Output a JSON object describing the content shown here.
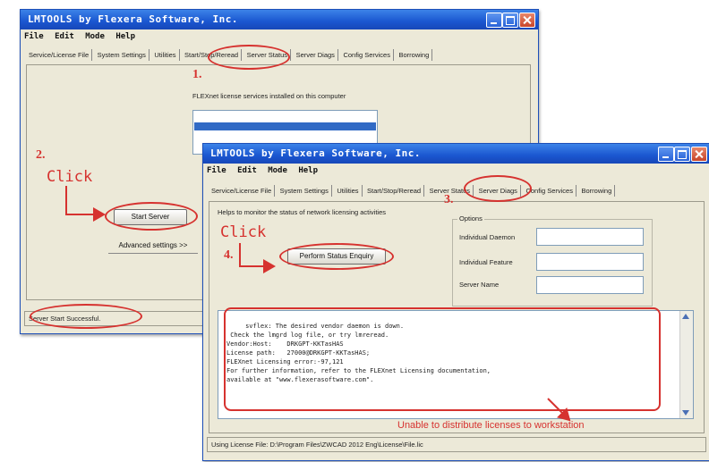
{
  "back_window": {
    "title": "LMTOOLS by Flexera Software, Inc.",
    "menu": [
      "File",
      "Edit",
      "Mode",
      "Help"
    ],
    "tabs": [
      "Service/License File",
      "System Settings",
      "Utilities",
      "Start/Stop/Reread",
      "Server Status",
      "Server Diags",
      "Config Services",
      "Borrowing"
    ],
    "heading": "FLEXnet license services installed on this computer",
    "start_server_label": "Start Server",
    "advanced_settings_label": "Advanced settings >>",
    "status_text": "Server Start Successful."
  },
  "front_window": {
    "title": "LMTOOLS by Flexera Software, Inc.",
    "menu": [
      "File",
      "Edit",
      "Mode",
      "Help"
    ],
    "tabs": [
      "Service/License File",
      "System Settings",
      "Utilities",
      "Start/Stop/Reread",
      "Server Status",
      "Server Diags",
      "Config Services",
      "Borrowing"
    ],
    "helps_text": "Helps to monitor the status of network licensing activities",
    "perform_label": "Perform Status Enquiry",
    "options_label": "Options",
    "individual_daemon_label": "Individual Daemon",
    "individual_feature_label": "Individual Feature",
    "server_name_label": "Server Name",
    "console_lines": [
      "     svflex: The desired vendor daemon is down.",
      " Check the lmgrd log file, or try lmreread.",
      "Vendor:Host:    DRKGPT-KKTasHAS",
      "License path:   27000@DRKGPT-KKTasHAS;",
      "FLEXnet Licensing error:-97,121",
      "For further information, refer to the FLEXnet Licensing documentation,",
      "available at \"www.flexerasoftware.com\"."
    ],
    "status_text": "Using License File:  D:\\Program Files\\ZWCAD 2012 Eng\\License\\File.lic"
  },
  "annotations": {
    "step1": "1.",
    "step2": "2.",
    "step3": "3.",
    "step4": "4.",
    "click1": "Click",
    "click2": "Click",
    "caption": "Unable to distribute licenses to workstation",
    "color": "#d6322f"
  },
  "colors": {
    "titlebar": "#1a56d0",
    "window_bg": "#ece9d8"
  }
}
